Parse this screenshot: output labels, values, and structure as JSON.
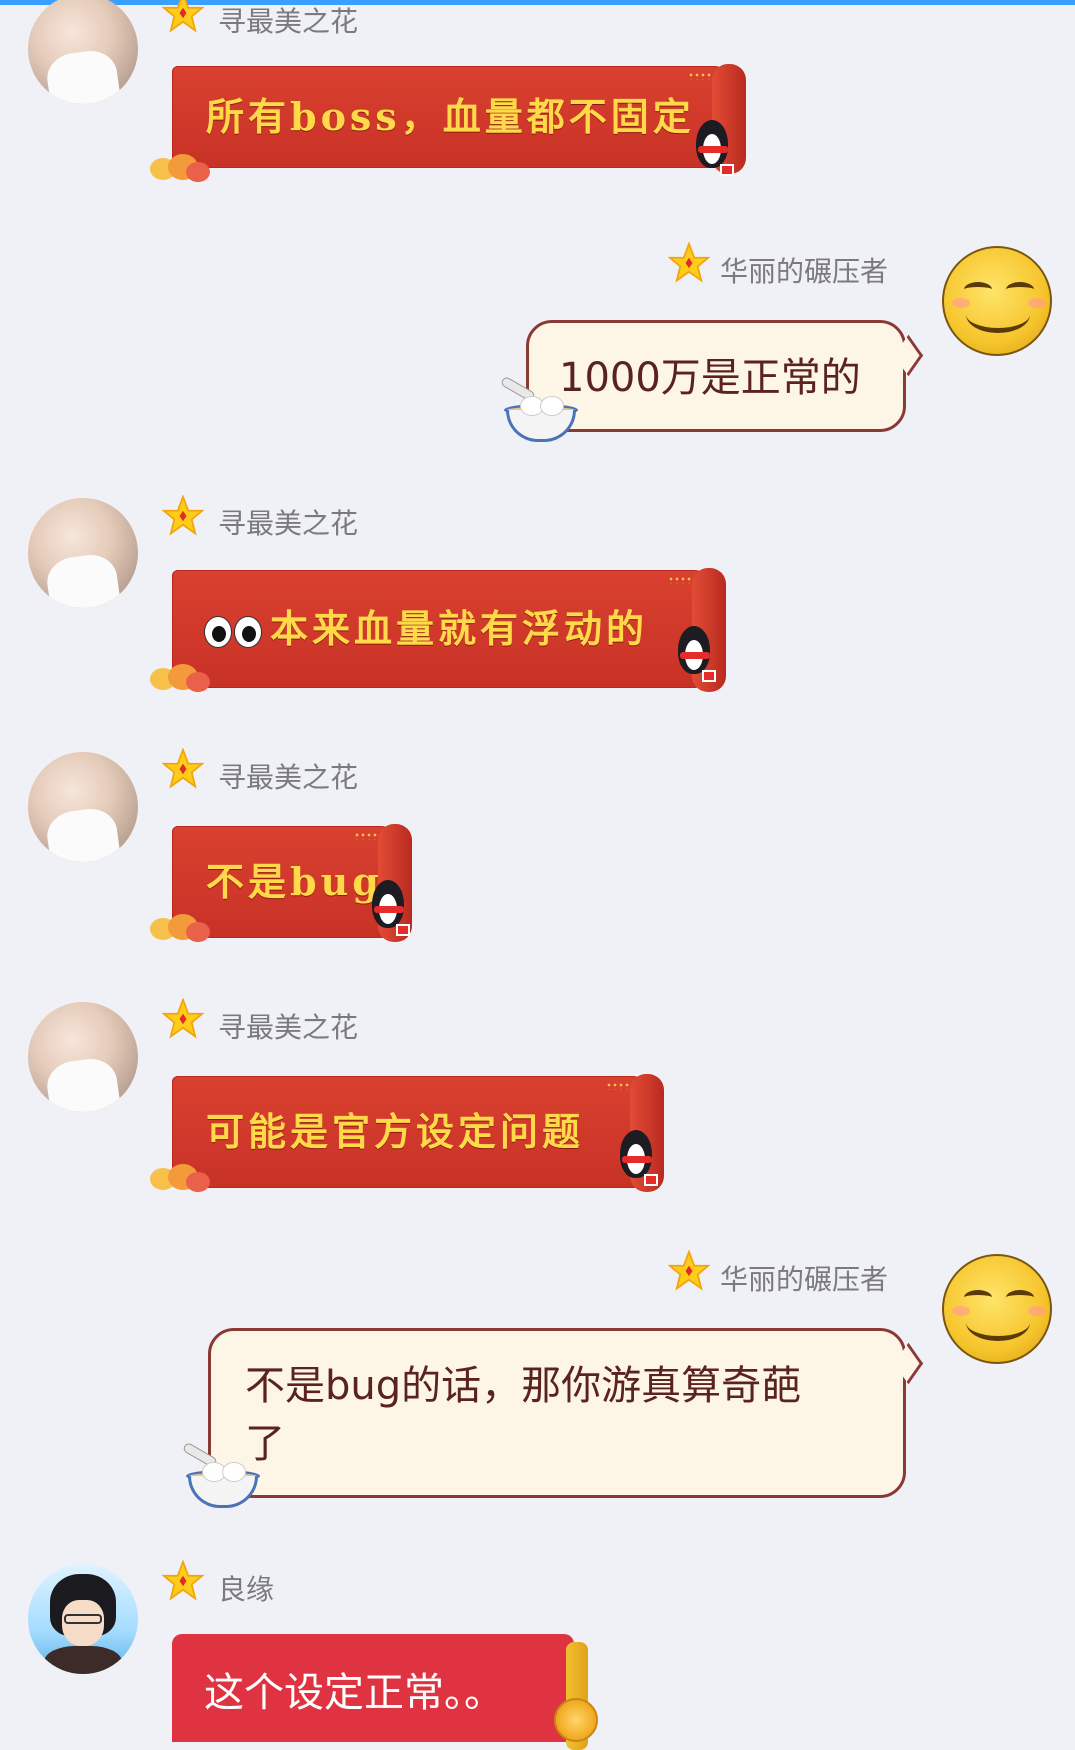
{
  "colors": {
    "background": "#f0f0f7",
    "red_bubble": "#c83226",
    "red_bubble_text": "#ffd94a",
    "cream_bubble": "#fdf6e6",
    "cream_border": "#8a3a35",
    "name_text": "#7a7a80",
    "accent_top": "#3aa0ff"
  },
  "messages": [
    {
      "sender": "寻最美之花",
      "text": "所有boss，血量都不固定",
      "side": "left",
      "avatar": "photo-avatar",
      "bubble": "red-envelope"
    },
    {
      "sender": "华丽的碾压者",
      "text": "1000万是正常的",
      "side": "right",
      "avatar": "smiley-avatar",
      "bubble": "cream"
    },
    {
      "sender": "寻最美之花",
      "text": "本来血量就有浮动的",
      "emoji": "eyes-icon",
      "side": "left",
      "avatar": "photo-avatar",
      "bubble": "red-envelope"
    },
    {
      "sender": "寻最美之花",
      "text": "不是bug",
      "side": "left",
      "avatar": "photo-avatar",
      "bubble": "red-envelope"
    },
    {
      "sender": "寻最美之花",
      "text": "可能是官方设定问题",
      "side": "left",
      "avatar": "photo-avatar",
      "bubble": "red-envelope"
    },
    {
      "sender": "华丽的碾压者",
      "text_line1": "不是bug的话，那你游真算奇葩",
      "text_line2": "了",
      "side": "right",
      "avatar": "smiley-avatar",
      "bubble": "cream"
    },
    {
      "sender": "良缘",
      "text": "这个设定正常。。",
      "side": "left",
      "avatar": "anime-avatar",
      "bubble": "red"
    }
  ]
}
